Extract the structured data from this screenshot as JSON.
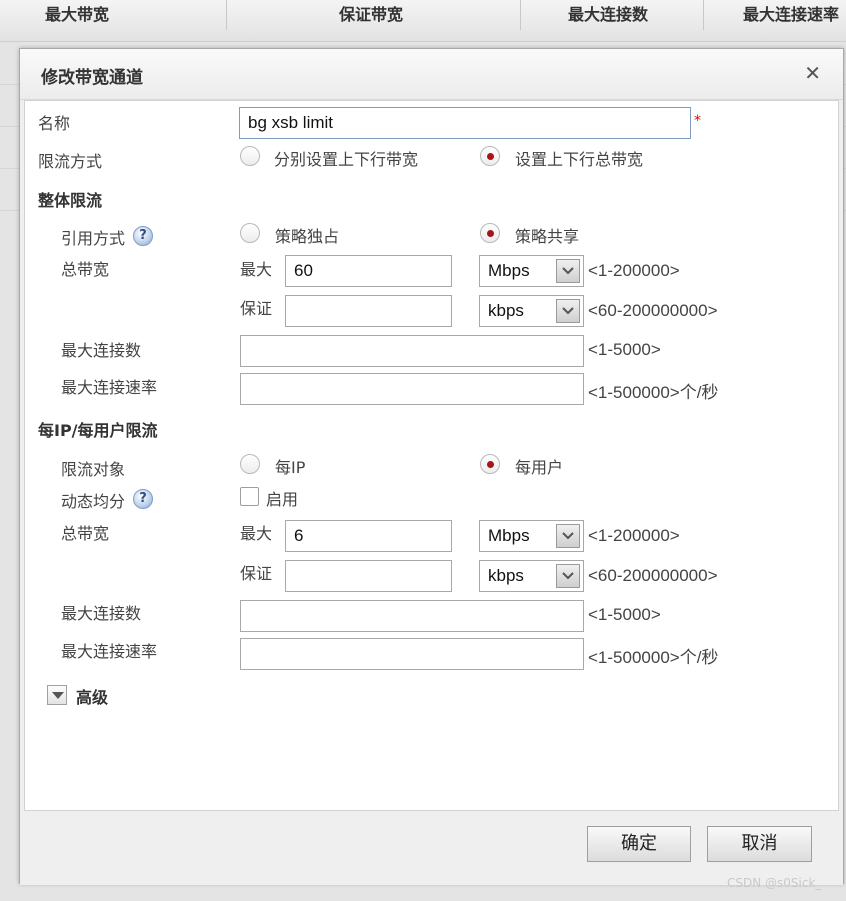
{
  "background_table": {
    "headers": [
      "最大带宽",
      "保证带宽",
      "最大连接数",
      "最大连接速率"
    ]
  },
  "dialog": {
    "title": "修改带宽通道",
    "close_glyph": "✕",
    "name_label": "名称",
    "name_value": "bg xsb limit",
    "required_mark": "*",
    "limit_mode": {
      "label": "限流方式",
      "options": [
        "分别设置上下行带宽",
        "设置上下行总带宽"
      ],
      "selected": "设置上下行总带宽"
    },
    "overall": {
      "section_title": "整体限流",
      "ref_mode": {
        "label": "引用方式",
        "options": [
          "策略独占",
          "策略共享"
        ],
        "selected": "策略共享"
      },
      "total_bandwidth_label": "总带宽",
      "max_label": "最大",
      "max_value": "60",
      "max_unit": "Mbps",
      "max_range": "<1-200000>",
      "guarantee_label": "保证",
      "guarantee_value": "",
      "guarantee_unit": "kbps",
      "guarantee_range": "<60-200000000>",
      "max_conn_label": "最大连接数",
      "max_conn_value": "",
      "max_conn_range": "<1-5000>",
      "max_conn_rate_label": "最大连接速率",
      "max_conn_rate_value": "",
      "max_conn_rate_range": "<1-500000>个/秒"
    },
    "per_ip": {
      "section_title": "每IP/每用户限流",
      "target": {
        "label": "限流对象",
        "options": [
          "每IP",
          "每用户"
        ],
        "selected": "每用户"
      },
      "dynamic": {
        "label": "动态均分",
        "checkbox_label": "启用",
        "checked": false
      },
      "total_bandwidth_label": "总带宽",
      "max_label": "最大",
      "max_value": "6",
      "max_unit": "Mbps",
      "max_range": "<1-200000>",
      "guarantee_label": "保证",
      "guarantee_value": "",
      "guarantee_unit": "kbps",
      "guarantee_range": "<60-200000000>",
      "max_conn_label": "最大连接数",
      "max_conn_value": "",
      "max_conn_range": "<1-5000>",
      "max_conn_rate_label": "最大连接速率",
      "max_conn_rate_value": "",
      "max_conn_rate_range": "<1-500000>个/秒"
    },
    "advanced_label": "高级",
    "ok_label": "确定",
    "cancel_label": "取消",
    "help_glyph": "?"
  },
  "watermark": "CSDN @s0Sick_",
  "colors": {
    "radio_selected": "#a4161a",
    "required": "#e00000",
    "help_icon": "#7f9ecb"
  }
}
